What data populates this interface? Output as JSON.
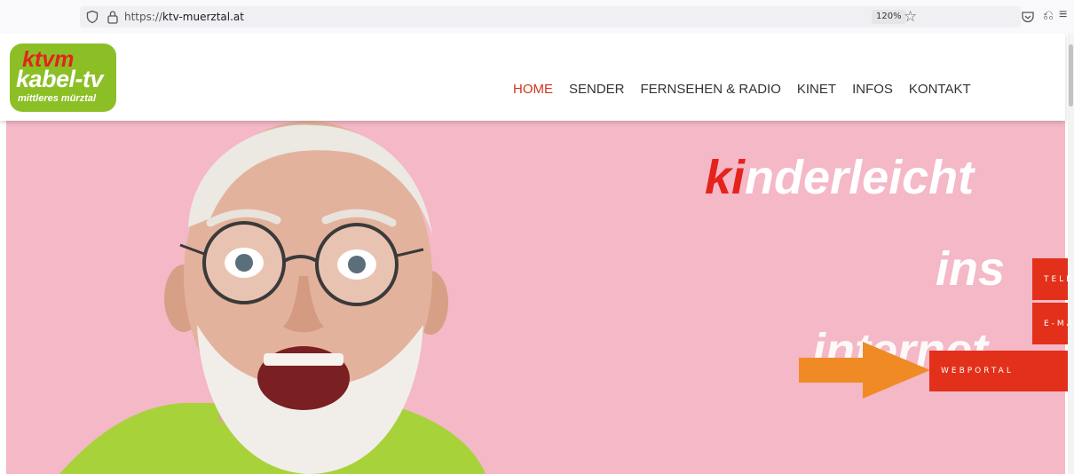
{
  "browser": {
    "url_prefix": "https://",
    "url_host": "ktv-muerztal.at",
    "zoom": "120%"
  },
  "logo": {
    "line1": "ktvm",
    "line2": "kabel-tv",
    "line3": "mittleres mürztal"
  },
  "nav": {
    "items": [
      "HOME",
      "SENDER",
      "FERNSEHEN & RADIO",
      "KINET",
      "INFOS",
      "KONTAKT"
    ],
    "active": "HOME"
  },
  "hero": {
    "word1_highlight": "ki",
    "word1_rest": "nderleicht",
    "word2": "ins",
    "word3": "internet"
  },
  "side_buttons": {
    "tel": "TELEFON",
    "mail": "E-MAIL",
    "web": "WEBPORTAL"
  },
  "colors": {
    "accent": "#e3301a",
    "logo_green": "#8cbf26",
    "hero_bg": "#f4b8c7",
    "arrow": "#f08a24"
  }
}
